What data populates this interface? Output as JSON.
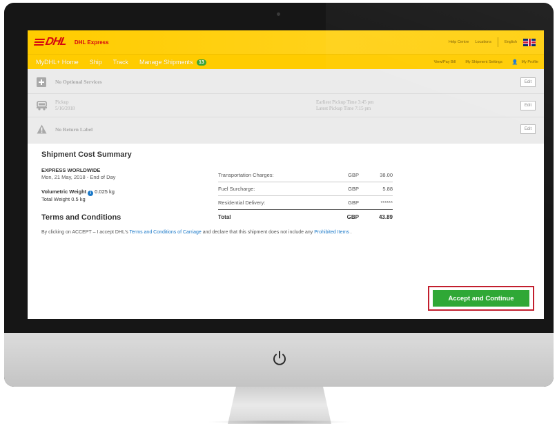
{
  "header": {
    "logo_text": "DHL",
    "brand_label": "DHL Express",
    "top_links": [
      "Help Centre",
      "Locations",
      "English"
    ]
  },
  "nav": {
    "items": [
      "MyDHL+ Home",
      "Ship",
      "Track",
      "Manage Shipments"
    ],
    "manage_badge": "13",
    "right_links": [
      "View/Pay Bill",
      "My Shipment Settings",
      "My Profile"
    ]
  },
  "options": {
    "optional_services": "No Optional Services",
    "pickup_label": "Pickup",
    "pickup_date": "5/16/2018",
    "earliest_pickup": "Earliest Pickup Time 3:45 pm",
    "latest_pickup": "Latest Pickup Time 7:15 pm",
    "return_label": "No Return Label",
    "edit_label": "Edit"
  },
  "summary": {
    "title": "Shipment Cost Summary",
    "service": "EXPRESS WORLDWIDE",
    "service_date": "Mon, 21 May, 2018 - End of Day",
    "volumetric_label": "Volumetric Weight",
    "volumetric_value": "0.025 kg",
    "total_weight": "Total Weight 0.5 kg",
    "costs": [
      {
        "label": "Transportation Charges:",
        "currency": "GBP",
        "value": "38.00"
      },
      {
        "label": "Fuel Surcharge:",
        "currency": "GBP",
        "value": "5.88"
      },
      {
        "label": "Residential Delivery:",
        "currency": "GBP",
        "value": "******"
      }
    ],
    "total": {
      "label": "Total",
      "currency": "GBP",
      "value": "43.89"
    }
  },
  "terms": {
    "title": "Terms and Conditions",
    "text_before": "By clicking on ACCEPT – I accept DHL's ",
    "link_terms": "Terms and Conditions of Carriage",
    "text_middle": " and declare that this shipment does not include any ",
    "link_prohibited": "Prohibited Items",
    "text_after": " ."
  },
  "actions": {
    "accept_label": "Accept and Continue"
  },
  "colors": {
    "dhl_yellow": "#ffcc00",
    "dhl_red": "#d40511",
    "accept_green": "#2fa836",
    "highlight_red": "#c21e2d",
    "link_blue": "#1978c8"
  }
}
